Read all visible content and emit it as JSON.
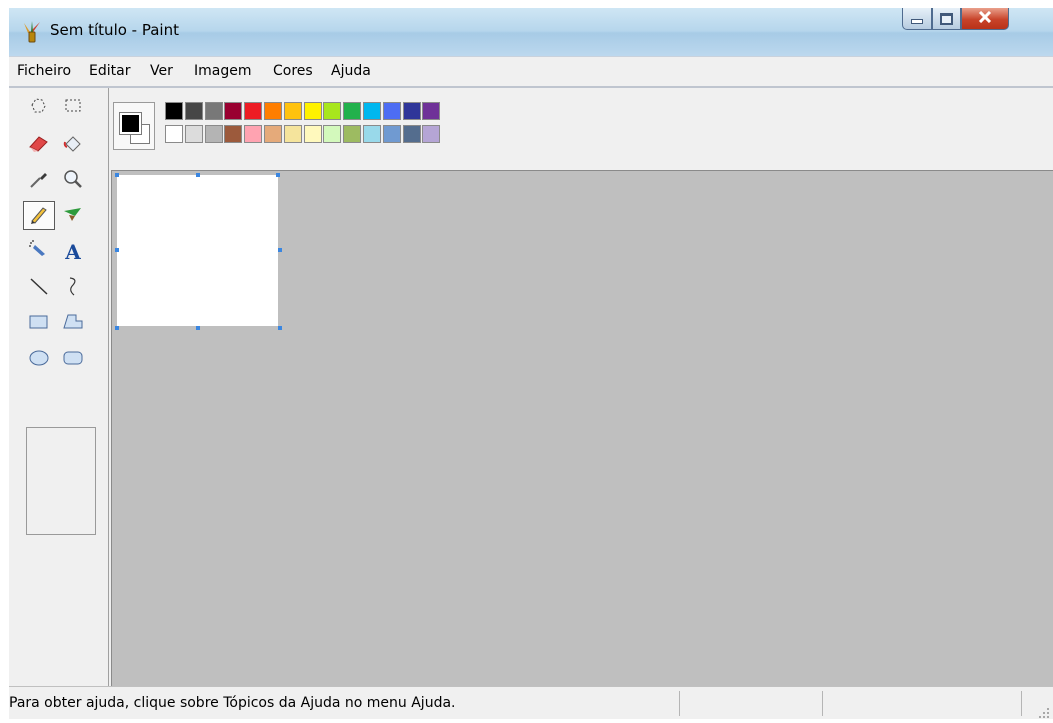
{
  "window": {
    "title": "Sem título - Paint"
  },
  "menu": {
    "items": [
      "Ficheiro",
      "Editar",
      "Ver",
      "Imagem",
      "Cores",
      "Ajuda"
    ]
  },
  "status": {
    "text": "Para obter ajuda, clique sobre Tópicos da Ajuda no menu Ajuda."
  },
  "tools": [
    {
      "name": "free-form-select-icon",
      "selected": false
    },
    {
      "name": "select-icon",
      "selected": false
    },
    {
      "name": "eraser-icon",
      "selected": false
    },
    {
      "name": "fill-bucket-icon",
      "selected": false
    },
    {
      "name": "color-picker-icon",
      "selected": false
    },
    {
      "name": "magnifier-icon",
      "selected": false
    },
    {
      "name": "pencil-icon",
      "selected": true
    },
    {
      "name": "brush-icon",
      "selected": false
    },
    {
      "name": "airbrush-icon",
      "selected": false
    },
    {
      "name": "text-icon",
      "selected": false
    },
    {
      "name": "line-icon",
      "selected": false
    },
    {
      "name": "curve-icon",
      "selected": false
    },
    {
      "name": "rectangle-icon",
      "selected": false
    },
    {
      "name": "polygon-icon",
      "selected": false
    },
    {
      "name": "ellipse-icon",
      "selected": false
    },
    {
      "name": "rounded-rectangle-icon",
      "selected": false
    }
  ],
  "tool_labels": {
    "text_tool": "A"
  },
  "colors": {
    "foreground": "#000000",
    "background": "#ffffff",
    "palette_top": [
      "#000000",
      "#464646",
      "#787878",
      "#990030",
      "#ed1c24",
      "#ff7e00",
      "#ffc20e",
      "#fff200",
      "#a8e61d",
      "#22b14c",
      "#00b7ef",
      "#4d6df3",
      "#2f3699",
      "#6f3198"
    ],
    "palette_bottom": [
      "#ffffff",
      "#dcdcdc",
      "#b4b4b4",
      "#9c5a3c",
      "#ffa3b1",
      "#e5aa7a",
      "#f5e49c",
      "#fff9bd",
      "#d3f9bc",
      "#9dbb61",
      "#99d9ea",
      "#709ad1",
      "#546d8e",
      "#b5a5d5"
    ]
  }
}
